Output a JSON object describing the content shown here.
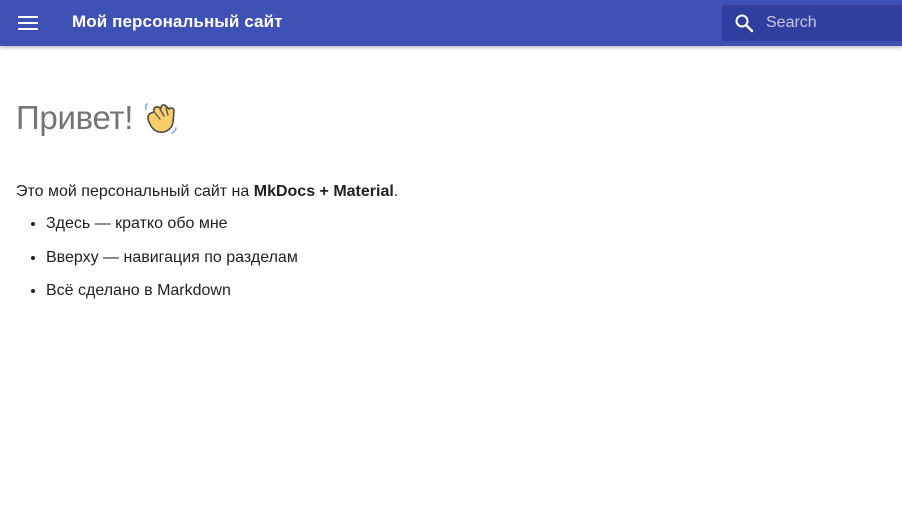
{
  "header": {
    "title": "Мой персональный сайт",
    "menu_icon": "menu-icon",
    "color": "#3f51b5"
  },
  "search": {
    "placeholder": "Search",
    "value": "",
    "icon": "search-icon",
    "color": "#303f9f"
  },
  "main": {
    "heading": "Привет!",
    "heading_icon": "waving-hand-icon",
    "intro": {
      "before": "Это мой персональный сайт на ",
      "bold": "MkDocs + Material",
      "after": "."
    },
    "list": [
      "Здесь — кратко обо мне",
      "Вверху — навигация по разделам",
      "Всё сделано в Markdown"
    ]
  }
}
